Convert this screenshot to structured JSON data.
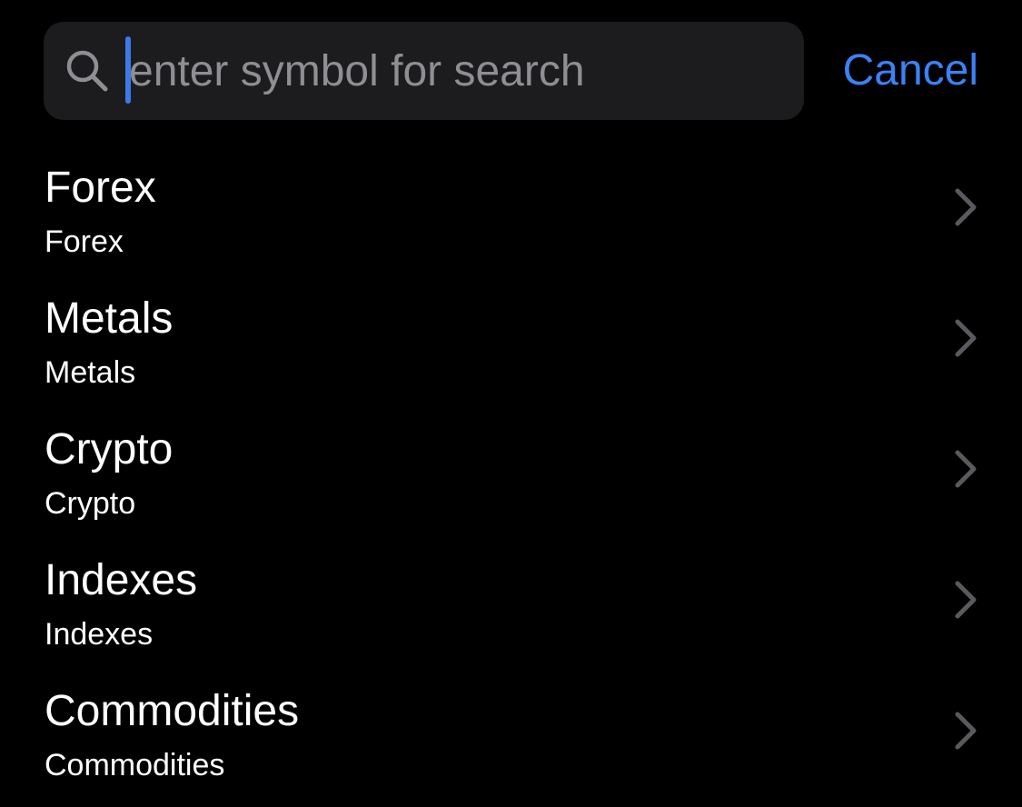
{
  "search": {
    "placeholder": "enter symbol for search",
    "value": "",
    "icon": "search-icon"
  },
  "cancel_label": "Cancel",
  "colors": {
    "background": "#000000",
    "search_field": "#1c1c1e",
    "accent": "#3b82f6",
    "caret": "#3b7ae8",
    "placeholder": "#8e8e93",
    "chevron": "#5a5a5e",
    "text": "#ffffff"
  },
  "categories": [
    {
      "title": "Forex",
      "subtitle": "Forex",
      "icon": "chevron-right-icon"
    },
    {
      "title": "Metals",
      "subtitle": "Metals",
      "icon": "chevron-right-icon"
    },
    {
      "title": "Crypto",
      "subtitle": "Crypto",
      "icon": "chevron-right-icon"
    },
    {
      "title": "Indexes",
      "subtitle": "Indexes",
      "icon": "chevron-right-icon"
    },
    {
      "title": "Commodities",
      "subtitle": "Commodities",
      "icon": "chevron-right-icon"
    }
  ]
}
